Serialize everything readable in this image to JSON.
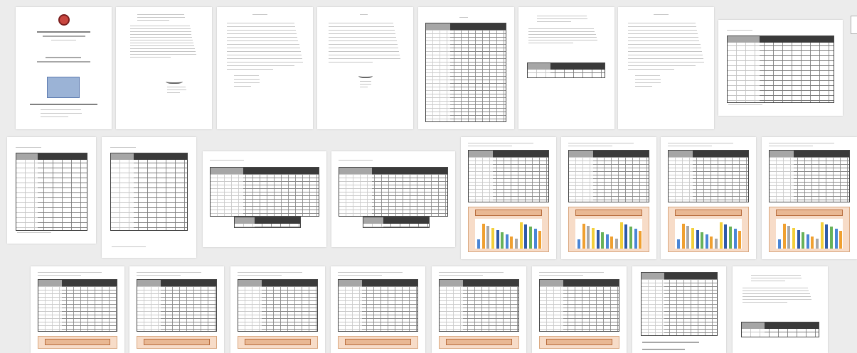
{
  "viewer": {
    "pages": [
      {
        "id": 1,
        "kind": "cover"
      },
      {
        "id": 2,
        "kind": "text-letter"
      },
      {
        "id": 3,
        "kind": "text-list"
      },
      {
        "id": 4,
        "kind": "text-signature"
      },
      {
        "id": 5,
        "kind": "toc"
      },
      {
        "id": 6,
        "kind": "text-table"
      },
      {
        "id": 7,
        "kind": "text-list"
      },
      {
        "id": 8,
        "kind": "table"
      },
      {
        "id": 9,
        "kind": "table"
      },
      {
        "id": 10,
        "kind": "table"
      },
      {
        "id": 11,
        "kind": "wide-table"
      },
      {
        "id": 12,
        "kind": "wide-table"
      },
      {
        "id": 13,
        "kind": "table-chart"
      },
      {
        "id": 14,
        "kind": "table-chart"
      },
      {
        "id": 15,
        "kind": "table-chart"
      },
      {
        "id": 16,
        "kind": "table-chart"
      },
      {
        "id": 17,
        "kind": "table-chart"
      },
      {
        "id": 18,
        "kind": "table-chart"
      },
      {
        "id": 19,
        "kind": "table-chart"
      },
      {
        "id": 20,
        "kind": "table-chart"
      },
      {
        "id": 21,
        "kind": "table-chart"
      },
      {
        "id": 22,
        "kind": "table-chart"
      },
      {
        "id": 23,
        "kind": "table-form"
      },
      {
        "id": 24,
        "kind": "text-table"
      }
    ],
    "colors": {
      "background": "#ececec",
      "page": "#ffffff",
      "chart_panel": "#f7dcc8",
      "bar_blue": "#4a86d6",
      "bar_orange": "#f0a030",
      "bar_gray": "#a8a8a8",
      "bar_yellow": "#f3cf3a",
      "bar_green": "#67b25a",
      "bar_navy": "#2f5aa8"
    }
  }
}
